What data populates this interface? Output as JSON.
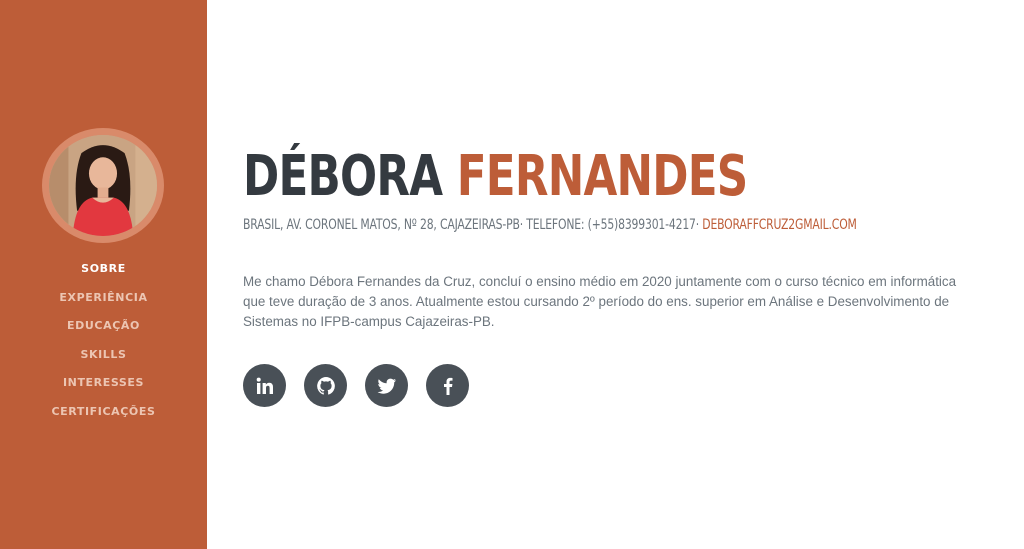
{
  "nav": {
    "items": [
      {
        "label": "SOBRE",
        "active": true
      },
      {
        "label": "EXPERIÊNCIA",
        "active": false
      },
      {
        "label": "EDUCAÇÃO",
        "active": false
      },
      {
        "label": "SKILLS",
        "active": false
      },
      {
        "label": "INTERESSES",
        "active": false
      },
      {
        "label": "CERTIFICAÇÕES",
        "active": false
      }
    ]
  },
  "profile": {
    "first_name": "DÉBORA",
    "last_name": "FERNANDES",
    "contact_text": "BRASIL, AV. CORONEL MATOS, Nº 28, CAJAZEIRAS-PB· TELEFONE: (+55)8399301-4217· ",
    "email": "DEBORAFFCRUZ2GMAIL.COM",
    "about": "Me chamo Débora Fernandes da Cruz, concluí o ensino médio em 2020 juntamente com o curso técnico em informática que teve duração de 3 anos. Atualmente estou cursando 2º período do ens. superior em Análise e Desenvolvimento de Sistemas no IFPB-campus Cajazeiras-PB."
  },
  "social": [
    {
      "icon": "linkedin-icon"
    },
    {
      "icon": "github-icon"
    },
    {
      "icon": "twitter-icon"
    },
    {
      "icon": "facebook-icon"
    }
  ],
  "colors": {
    "accent": "#bd5d38",
    "dark": "#343a40",
    "muted": "#6c757d",
    "social_bg": "#495057"
  }
}
